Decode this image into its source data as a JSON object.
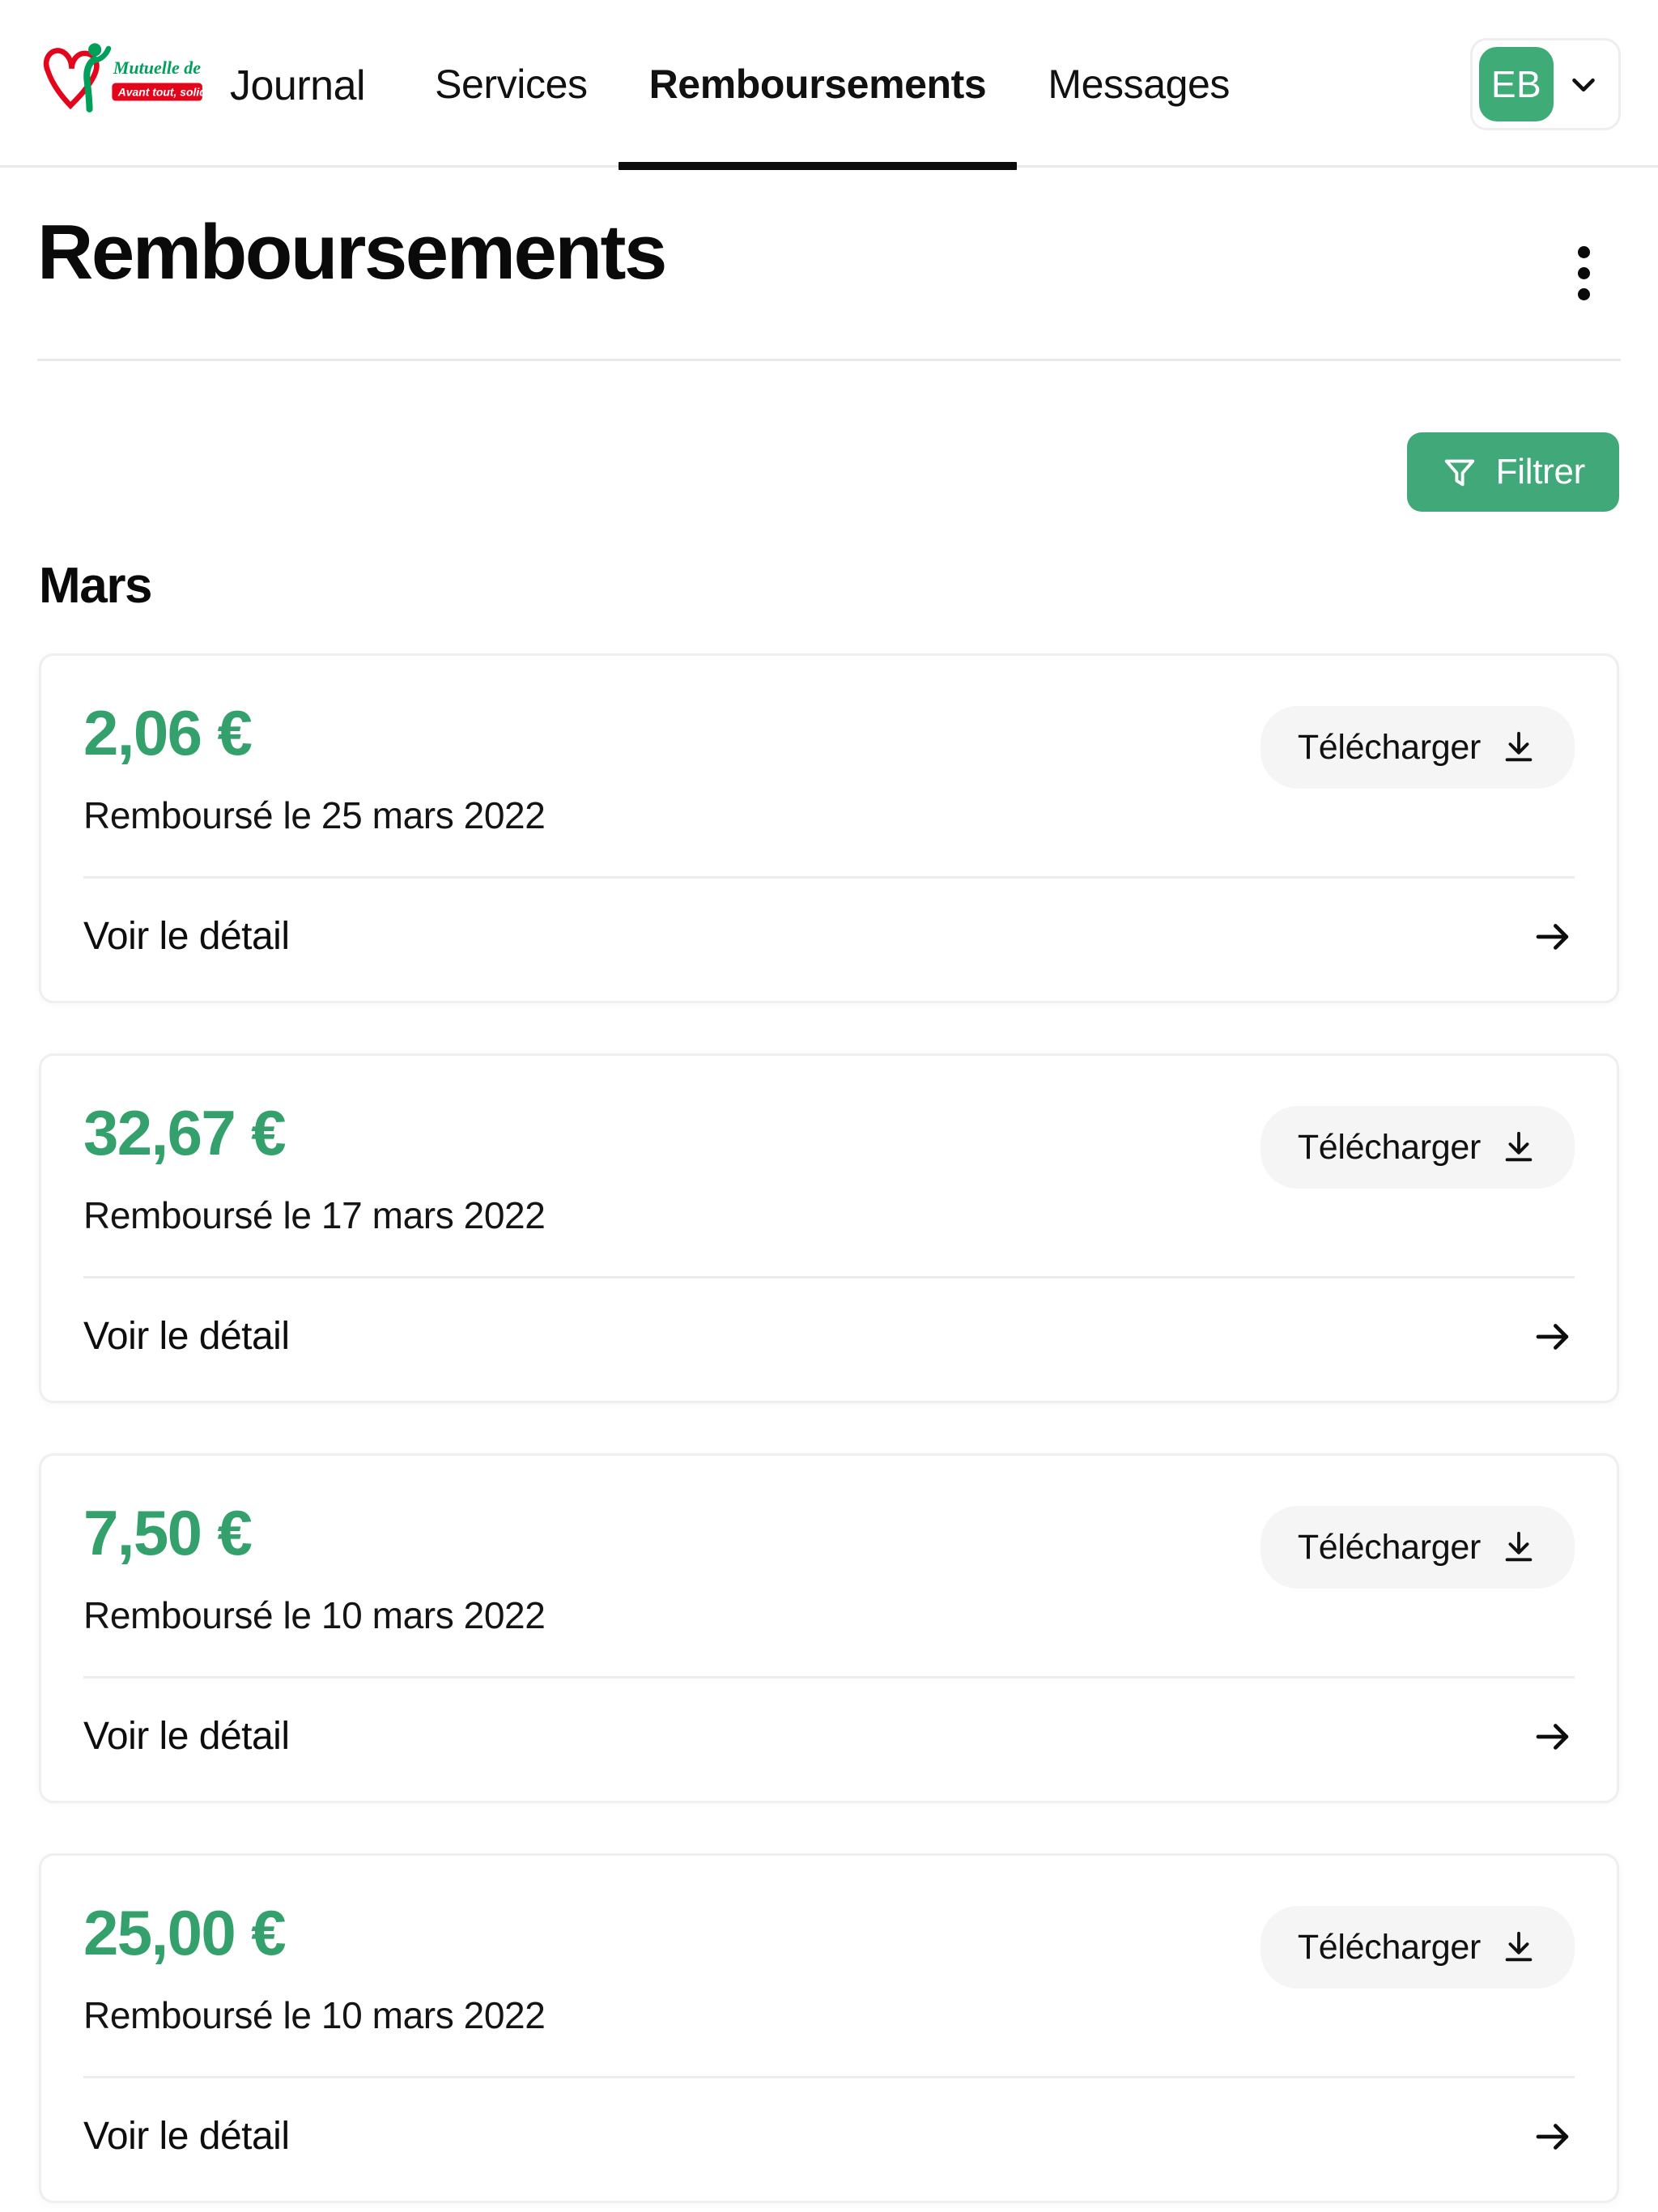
{
  "header": {
    "brand_name": "Mutuelle de France Unie",
    "brand_tagline": "Avant tout, solidaire !",
    "app_name": "Journal",
    "nav_items": [
      {
        "label": "Services",
        "active": false
      },
      {
        "label": "Remboursements",
        "active": true
      },
      {
        "label": "Messages",
        "active": false
      }
    ],
    "account": {
      "initials": "EB",
      "chevron_icon": "chevron-down-icon"
    },
    "brand_colors": {
      "green": "#00a05a",
      "red": "#e3051b"
    }
  },
  "page": {
    "title": "Remboursements",
    "overflow_menu_icon": "kebab-menu-icon"
  },
  "toolbar": {
    "filter_label": "Filtrer",
    "filter_icon": "funnel-icon",
    "filter_color": "#41a87a"
  },
  "content": {
    "month_heading": "Mars",
    "accent_green": "#34a06b",
    "download_label": "Télécharger",
    "download_icon": "download-icon",
    "detail_label": "Voir le détail",
    "detail_icon": "arrow-right-icon",
    "refunds": [
      {
        "amount": "2,06 €",
        "date_text": "Remboursé le 25 mars 2022",
        "download_label": "Télécharger",
        "detail_label": "Voir le détail"
      },
      {
        "amount": "32,67 €",
        "date_text": "Remboursé le 17 mars 2022",
        "download_label": "Télécharger",
        "detail_label": "Voir le détail"
      },
      {
        "amount": "7,50 €",
        "date_text": "Remboursé le 10 mars 2022",
        "download_label": "Télécharger",
        "detail_label": "Voir le détail"
      },
      {
        "amount": "25,00 €",
        "date_text": "Remboursé le 10 mars 2022",
        "download_label": "Télécharger",
        "detail_label": "Voir le détail"
      }
    ]
  }
}
